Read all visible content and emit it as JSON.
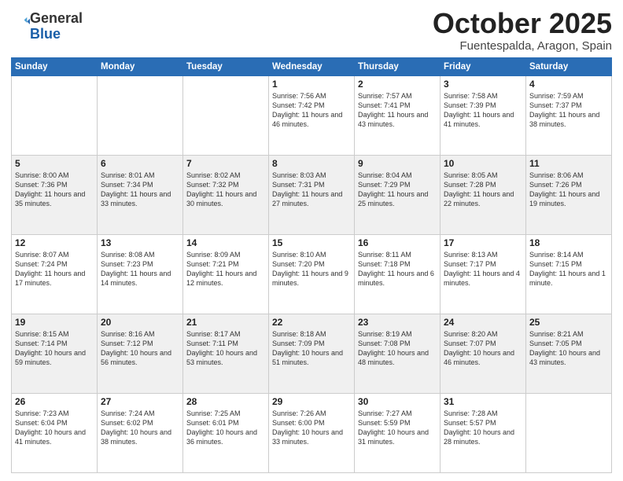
{
  "header": {
    "logo_general": "General",
    "logo_blue": "Blue",
    "month": "October 2025",
    "location": "Fuentespalda, Aragon, Spain"
  },
  "days_of_week": [
    "Sunday",
    "Monday",
    "Tuesday",
    "Wednesday",
    "Thursday",
    "Friday",
    "Saturday"
  ],
  "weeks": [
    [
      {
        "day": "",
        "info": ""
      },
      {
        "day": "",
        "info": ""
      },
      {
        "day": "",
        "info": ""
      },
      {
        "day": "1",
        "info": "Sunrise: 7:56 AM\nSunset: 7:42 PM\nDaylight: 11 hours\nand 46 minutes."
      },
      {
        "day": "2",
        "info": "Sunrise: 7:57 AM\nSunset: 7:41 PM\nDaylight: 11 hours\nand 43 minutes."
      },
      {
        "day": "3",
        "info": "Sunrise: 7:58 AM\nSunset: 7:39 PM\nDaylight: 11 hours\nand 41 minutes."
      },
      {
        "day": "4",
        "info": "Sunrise: 7:59 AM\nSunset: 7:37 PM\nDaylight: 11 hours\nand 38 minutes."
      }
    ],
    [
      {
        "day": "5",
        "info": "Sunrise: 8:00 AM\nSunset: 7:36 PM\nDaylight: 11 hours\nand 35 minutes."
      },
      {
        "day": "6",
        "info": "Sunrise: 8:01 AM\nSunset: 7:34 PM\nDaylight: 11 hours\nand 33 minutes."
      },
      {
        "day": "7",
        "info": "Sunrise: 8:02 AM\nSunset: 7:32 PM\nDaylight: 11 hours\nand 30 minutes."
      },
      {
        "day": "8",
        "info": "Sunrise: 8:03 AM\nSunset: 7:31 PM\nDaylight: 11 hours\nand 27 minutes."
      },
      {
        "day": "9",
        "info": "Sunrise: 8:04 AM\nSunset: 7:29 PM\nDaylight: 11 hours\nand 25 minutes."
      },
      {
        "day": "10",
        "info": "Sunrise: 8:05 AM\nSunset: 7:28 PM\nDaylight: 11 hours\nand 22 minutes."
      },
      {
        "day": "11",
        "info": "Sunrise: 8:06 AM\nSunset: 7:26 PM\nDaylight: 11 hours\nand 19 minutes."
      }
    ],
    [
      {
        "day": "12",
        "info": "Sunrise: 8:07 AM\nSunset: 7:24 PM\nDaylight: 11 hours\nand 17 minutes."
      },
      {
        "day": "13",
        "info": "Sunrise: 8:08 AM\nSunset: 7:23 PM\nDaylight: 11 hours\nand 14 minutes."
      },
      {
        "day": "14",
        "info": "Sunrise: 8:09 AM\nSunset: 7:21 PM\nDaylight: 11 hours\nand 12 minutes."
      },
      {
        "day": "15",
        "info": "Sunrise: 8:10 AM\nSunset: 7:20 PM\nDaylight: 11 hours\nand 9 minutes."
      },
      {
        "day": "16",
        "info": "Sunrise: 8:11 AM\nSunset: 7:18 PM\nDaylight: 11 hours\nand 6 minutes."
      },
      {
        "day": "17",
        "info": "Sunrise: 8:13 AM\nSunset: 7:17 PM\nDaylight: 11 hours\nand 4 minutes."
      },
      {
        "day": "18",
        "info": "Sunrise: 8:14 AM\nSunset: 7:15 PM\nDaylight: 11 hours\nand 1 minute."
      }
    ],
    [
      {
        "day": "19",
        "info": "Sunrise: 8:15 AM\nSunset: 7:14 PM\nDaylight: 10 hours\nand 59 minutes."
      },
      {
        "day": "20",
        "info": "Sunrise: 8:16 AM\nSunset: 7:12 PM\nDaylight: 10 hours\nand 56 minutes."
      },
      {
        "day": "21",
        "info": "Sunrise: 8:17 AM\nSunset: 7:11 PM\nDaylight: 10 hours\nand 53 minutes."
      },
      {
        "day": "22",
        "info": "Sunrise: 8:18 AM\nSunset: 7:09 PM\nDaylight: 10 hours\nand 51 minutes."
      },
      {
        "day": "23",
        "info": "Sunrise: 8:19 AM\nSunset: 7:08 PM\nDaylight: 10 hours\nand 48 minutes."
      },
      {
        "day": "24",
        "info": "Sunrise: 8:20 AM\nSunset: 7:07 PM\nDaylight: 10 hours\nand 46 minutes."
      },
      {
        "day": "25",
        "info": "Sunrise: 8:21 AM\nSunset: 7:05 PM\nDaylight: 10 hours\nand 43 minutes."
      }
    ],
    [
      {
        "day": "26",
        "info": "Sunrise: 7:23 AM\nSunset: 6:04 PM\nDaylight: 10 hours\nand 41 minutes."
      },
      {
        "day": "27",
        "info": "Sunrise: 7:24 AM\nSunset: 6:02 PM\nDaylight: 10 hours\nand 38 minutes."
      },
      {
        "day": "28",
        "info": "Sunrise: 7:25 AM\nSunset: 6:01 PM\nDaylight: 10 hours\nand 36 minutes."
      },
      {
        "day": "29",
        "info": "Sunrise: 7:26 AM\nSunset: 6:00 PM\nDaylight: 10 hours\nand 33 minutes."
      },
      {
        "day": "30",
        "info": "Sunrise: 7:27 AM\nSunset: 5:59 PM\nDaylight: 10 hours\nand 31 minutes."
      },
      {
        "day": "31",
        "info": "Sunrise: 7:28 AM\nSunset: 5:57 PM\nDaylight: 10 hours\nand 28 minutes."
      },
      {
        "day": "",
        "info": ""
      }
    ]
  ]
}
